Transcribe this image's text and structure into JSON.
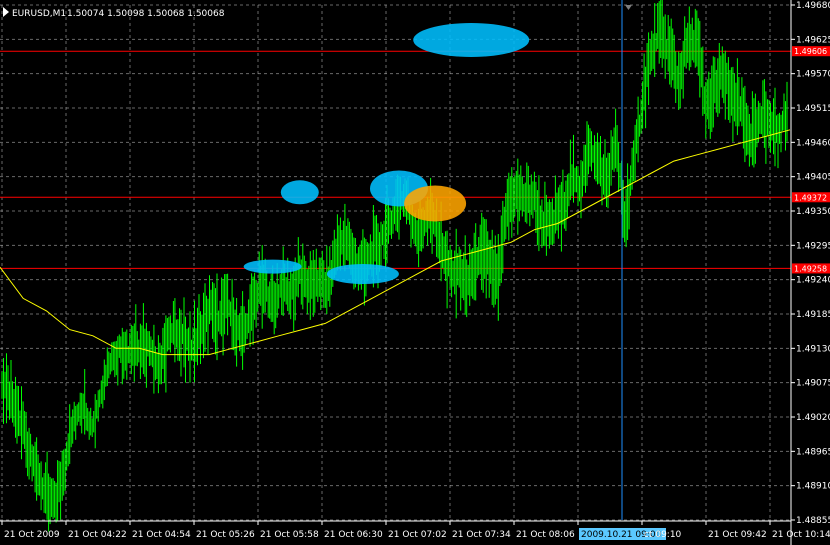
{
  "header": {
    "symbol": "EURUSD,M1",
    "ohlc": "1.50074 1.50098 1.50068 1.50068"
  },
  "crosshair": {
    "time_label": "2009.10.21 09:00"
  },
  "colors": {
    "background": "#000000",
    "grid": "#c0c0c0",
    "candles": "#00ff00",
    "moving_average": "#ffff00",
    "levels": "#ff0000",
    "crosshair": "#1e90ff",
    "highlight_blue": "#00bfff",
    "highlight_orange": "#ffa500"
  },
  "chart_data": {
    "type": "line",
    "title": "EURUSD,M1",
    "xlabel": "",
    "ylabel": "",
    "ylim": [
      1.48855,
      1.4968
    ],
    "grid": true,
    "x_tick_labels": [
      "21 Oct 2009",
      "21 Oct 04:22",
      "21 Oct 04:54",
      "21 Oct 05:26",
      "21 Oct 05:58",
      "21 Oct 06:30",
      "21 Oct 07:02",
      "21 Oct 07:34",
      "21 Oct 08:06",
      "2009.10.21 09:00",
      "ct 09:10",
      "21 Oct 09:42",
      "21 Oct 10:14"
    ],
    "y_tick_labels": [
      "1.49680",
      "1.49625",
      "1.49570",
      "1.49515",
      "1.49460",
      "1.49405",
      "1.49350",
      "1.49295",
      "1.49240",
      "1.49185",
      "1.49130",
      "1.49075",
      "1.49020",
      "1.48965",
      "1.48910",
      "1.48855"
    ],
    "level_lines": [
      {
        "value": 1.49606,
        "label": "1.49606"
      },
      {
        "value": 1.49372,
        "label": "1.49372"
      },
      {
        "value": 1.49258,
        "label": "1.49258"
      }
    ],
    "series": [
      {
        "kind": "price",
        "values": [
          1.4908,
          1.4905,
          1.4901,
          1.4897,
          1.4893,
          1.4889,
          1.4888,
          1.4895,
          1.4901,
          1.4904,
          1.49,
          1.4906,
          1.4911,
          1.4913,
          1.4912,
          1.4913,
          1.4914,
          1.491,
          1.4913,
          1.4916,
          1.4915,
          1.4913,
          1.4916,
          1.4919,
          1.4918,
          1.492,
          1.4916,
          1.4916,
          1.4921,
          1.4923,
          1.492,
          1.4923,
          1.4922,
          1.4925,
          1.4923,
          1.4924,
          1.4923,
          1.4928,
          1.4931,
          1.4927,
          1.4926,
          1.4928,
          1.493,
          1.4933,
          1.4937,
          1.4936,
          1.4931,
          1.4934,
          1.4933,
          1.4928,
          1.4925,
          1.4925,
          1.4924,
          1.4929,
          1.4927,
          1.4924,
          1.4936,
          1.4938,
          1.4937,
          1.4937,
          1.4933,
          1.4933,
          1.4935,
          1.494,
          1.4939,
          1.4945,
          1.4943,
          1.494,
          1.4946,
          1.4934,
          1.4942,
          1.4953,
          1.4961,
          1.4964,
          1.496,
          1.4956,
          1.4962,
          1.4963,
          1.4951,
          1.4955,
          1.4957,
          1.4953,
          1.4951,
          1.4947,
          1.4949,
          1.495,
          1.4947,
          1.4951
        ]
      },
      {
        "kind": "moving_average",
        "values": [
          1.4926,
          1.4921,
          1.4919,
          1.4916,
          1.4915,
          1.4913,
          1.4913,
          1.4912,
          1.4912,
          1.4912,
          1.4913,
          1.4914,
          1.4915,
          1.4916,
          1.4917,
          1.4919,
          1.4921,
          1.4923,
          1.4925,
          1.4927,
          1.4928,
          1.4929,
          1.493,
          1.4932,
          1.4933,
          1.4935,
          1.4937,
          1.4939,
          1.4941,
          1.4943,
          1.4944,
          1.4945,
          1.4946,
          1.4947,
          1.4948
        ]
      }
    ],
    "highlights": [
      {
        "color": "blue",
        "x_index": 52,
        "value": 1.49624
      },
      {
        "color": "blue",
        "x_index": 33,
        "value": 1.4938
      },
      {
        "color": "blue",
        "x_index": 44,
        "value": 1.49386
      },
      {
        "color": "blue",
        "x_index": 30,
        "value": 1.49261
      },
      {
        "color": "blue",
        "x_index": 40,
        "value": 1.49249
      },
      {
        "color": "orange",
        "x_index": 48,
        "value": 1.49362
      }
    ]
  }
}
